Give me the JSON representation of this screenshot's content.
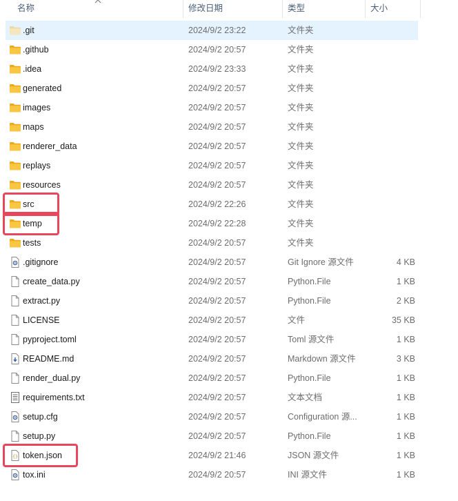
{
  "header": {
    "name": "名称",
    "modified": "修改日期",
    "type": "类型",
    "size": "大小"
  },
  "files": [
    {
      "name": ".git",
      "modified": "2024/9/2 23:22",
      "type": "文件夹",
      "size": "",
      "icon": "folder-icon",
      "selected": true
    },
    {
      "name": ".github",
      "modified": "2024/9/2 20:57",
      "type": "文件夹",
      "size": "",
      "icon": "folder-icon"
    },
    {
      "name": ".idea",
      "modified": "2024/9/2 23:33",
      "type": "文件夹",
      "size": "",
      "icon": "folder-icon"
    },
    {
      "name": "generated",
      "modified": "2024/9/2 20:57",
      "type": "文件夹",
      "size": "",
      "icon": "folder-icon"
    },
    {
      "name": "images",
      "modified": "2024/9/2 20:57",
      "type": "文件夹",
      "size": "",
      "icon": "folder-icon"
    },
    {
      "name": "maps",
      "modified": "2024/9/2 20:57",
      "type": "文件夹",
      "size": "",
      "icon": "folder-icon"
    },
    {
      "name": "renderer_data",
      "modified": "2024/9/2 20:57",
      "type": "文件夹",
      "size": "",
      "icon": "folder-icon"
    },
    {
      "name": "replays",
      "modified": "2024/9/2 20:57",
      "type": "文件夹",
      "size": "",
      "icon": "folder-icon"
    },
    {
      "name": "resources",
      "modified": "2024/9/2 20:57",
      "type": "文件夹",
      "size": "",
      "icon": "folder-icon"
    },
    {
      "name": "src",
      "modified": "2024/9/2 22:26",
      "type": "文件夹",
      "size": "",
      "icon": "folder-icon",
      "highlight": true
    },
    {
      "name": "temp",
      "modified": "2024/9/2 22:28",
      "type": "文件夹",
      "size": "",
      "icon": "folder-icon",
      "highlight": true
    },
    {
      "name": "tests",
      "modified": "2024/9/2 20:57",
      "type": "文件夹",
      "size": "",
      "icon": "folder-icon"
    },
    {
      "name": ".gitignore",
      "modified": "2024/9/2 20:57",
      "type": "Git Ignore 源文件",
      "size": "4 KB",
      "icon": "gear-file-icon"
    },
    {
      "name": "create_data.py",
      "modified": "2024/9/2 20:57",
      "type": "Python.File",
      "size": "1 KB",
      "icon": "file-icon"
    },
    {
      "name": "extract.py",
      "modified": "2024/9/2 20:57",
      "type": "Python.File",
      "size": "2 KB",
      "icon": "file-icon"
    },
    {
      "name": "LICENSE",
      "modified": "2024/9/2 20:57",
      "type": "文件",
      "size": "35 KB",
      "icon": "file-icon"
    },
    {
      "name": "pyproject.toml",
      "modified": "2024/9/2 20:57",
      "type": "Toml 源文件",
      "size": "1 KB",
      "icon": "file-icon"
    },
    {
      "name": "README.md",
      "modified": "2024/9/2 20:57",
      "type": "Markdown 源文件",
      "size": "3 KB",
      "icon": "markdown-file-icon"
    },
    {
      "name": "render_dual.py",
      "modified": "2024/9/2 20:57",
      "type": "Python.File",
      "size": "1 KB",
      "icon": "file-icon"
    },
    {
      "name": "requirements.txt",
      "modified": "2024/9/2 20:57",
      "type": "文本文档",
      "size": "1 KB",
      "icon": "text-file-icon"
    },
    {
      "name": "setup.cfg",
      "modified": "2024/9/2 20:57",
      "type": "Configuration 源...",
      "size": "1 KB",
      "icon": "gear-file-icon"
    },
    {
      "name": "setup.py",
      "modified": "2024/9/2 20:57",
      "type": "Python.File",
      "size": "1 KB",
      "icon": "file-icon"
    },
    {
      "name": "token.json",
      "modified": "2024/9/2 21:46",
      "type": "JSON 源文件",
      "size": "1 KB",
      "icon": "json-file-icon",
      "highlight": true
    },
    {
      "name": "tox.ini",
      "modified": "2024/9/2 20:57",
      "type": "INI 源文件",
      "size": "1 KB",
      "icon": "gear-file-icon"
    }
  ],
  "colors": {
    "selected_row": "#e5f3ff",
    "highlight_border": "#e8465f",
    "folder": "#f8c640"
  }
}
